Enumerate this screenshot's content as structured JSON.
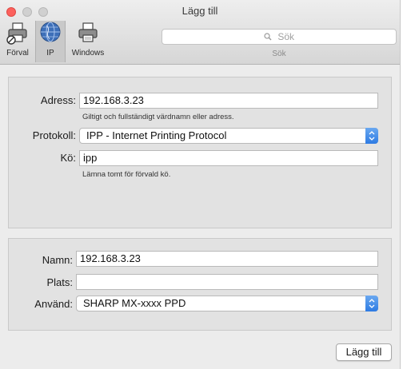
{
  "window": {
    "title": "Lägg till"
  },
  "toolbar": {
    "items": [
      {
        "label": "Förval",
        "icon": "printer-default-icon"
      },
      {
        "label": "IP",
        "icon": "globe-icon",
        "selected": true
      },
      {
        "label": "Windows",
        "icon": "printer-windows-icon"
      }
    ]
  },
  "search": {
    "placeholder": "Sök",
    "caption": "Sök"
  },
  "form": {
    "address_label": "Adress:",
    "address_value": "192.168.3.23",
    "address_hint": "Giltigt och fullständigt värdnamn eller adress.",
    "protocol_label": "Protokoll:",
    "protocol_value": "IPP - Internet Printing Protocol",
    "queue_label": "Kö:",
    "queue_value": "ipp",
    "queue_hint": "Lämna tomt för förvald kö.",
    "name_label": "Namn:",
    "name_value": "192.168.3.23",
    "location_label": "Plats:",
    "location_value": "",
    "use_label": "Använd:",
    "use_value": "SHARP MX-xxxx PPD"
  },
  "buttons": {
    "add": "Lägg till"
  },
  "colors": {
    "accent": "#2d7be3",
    "close": "#fc615d"
  }
}
